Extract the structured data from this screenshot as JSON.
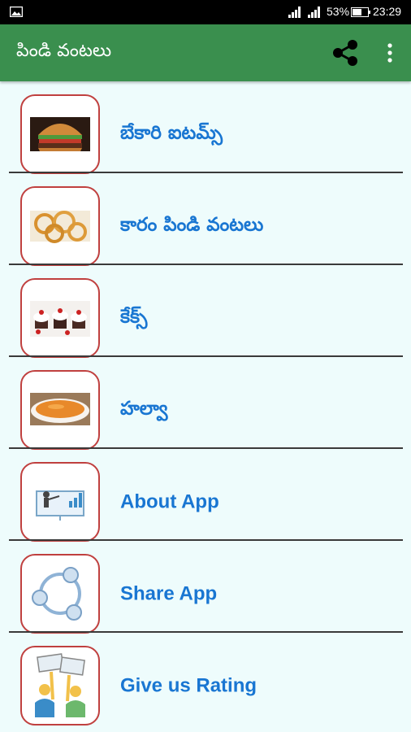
{
  "status_bar": {
    "battery_percent": "53%",
    "time": "23:29",
    "icons": [
      "gallery-icon",
      "signal-icon",
      "signal-icon",
      "battery-icon"
    ]
  },
  "app_bar": {
    "title": "పిండి వంటలు",
    "actions": [
      "share-icon",
      "more-vert-icon"
    ],
    "color": "#3a8f4e"
  },
  "menu": {
    "items": [
      {
        "label": "బేకారి ఐటమ్స్",
        "icon": "burger-image"
      },
      {
        "label": "కారం పిండి వంటలు",
        "icon": "murukku-image"
      },
      {
        "label": "కేక్స్",
        "icon": "cupcakes-image"
      },
      {
        "label": "హల్వా",
        "icon": "halwa-image"
      },
      {
        "label": "About App",
        "icon": "presentation-icon"
      },
      {
        "label": "Share App",
        "icon": "share-circle-icon"
      },
      {
        "label": "Give us Rating",
        "icon": "rating-people-icon"
      }
    ]
  },
  "colors": {
    "background": "#eefcfc",
    "label": "#1976d2",
    "thumb_border": "#c0403f"
  }
}
